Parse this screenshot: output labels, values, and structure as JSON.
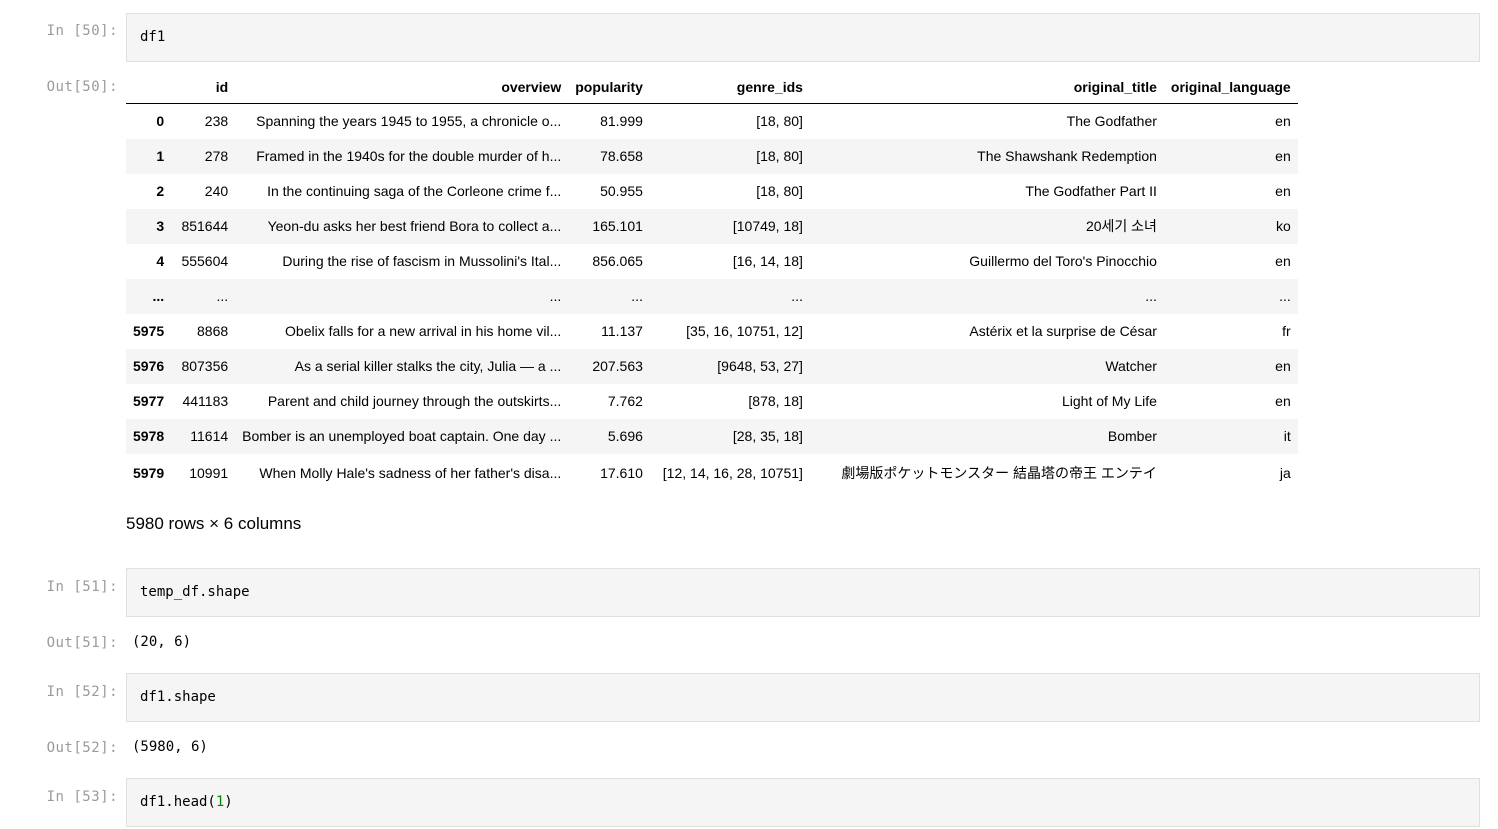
{
  "cells": [
    {
      "in_prompt": "In [50]:",
      "code": "df1",
      "out_prompt": "Out[50]:"
    },
    {
      "in_prompt": "In [51]:",
      "code": "temp_df.shape",
      "out_prompt": "Out[51]:",
      "output": "(20, 6)"
    },
    {
      "in_prompt": "In [52]:",
      "code": "df1.shape",
      "out_prompt": "Out[52]:",
      "output": "(5980, 6)"
    },
    {
      "in_prompt": "In [53]:",
      "code_prefix": "df1.head(",
      "code_arg": "1",
      "code_suffix": ")"
    }
  ],
  "dataframe": {
    "columns": [
      "",
      "id",
      "overview",
      "popularity",
      "genre_ids",
      "original_title",
      "original_language"
    ],
    "rows": [
      [
        "0",
        "238",
        "Spanning the years 1945 to 1955, a chronicle o...",
        "81.999",
        "[18, 80]",
        "The Godfather",
        "en"
      ],
      [
        "1",
        "278",
        "Framed in the 1940s for the double murder of h...",
        "78.658",
        "[18, 80]",
        "The Shawshank Redemption",
        "en"
      ],
      [
        "2",
        "240",
        "In the continuing saga of the Corleone crime f...",
        "50.955",
        "[18, 80]",
        "The Godfather Part II",
        "en"
      ],
      [
        "3",
        "851644",
        "Yeon-du asks her best friend Bora to collect a...",
        "165.101",
        "[10749, 18]",
        "20세기 소녀",
        "ko"
      ],
      [
        "4",
        "555604",
        "During the rise of fascism in Mussolini's Ital...",
        "856.065",
        "[16, 14, 18]",
        "Guillermo del Toro's Pinocchio",
        "en"
      ],
      [
        "...",
        "...",
        "...",
        "...",
        "...",
        "...",
        "..."
      ],
      [
        "5975",
        "8868",
        "Obelix falls for a new arrival in his home vil...",
        "11.137",
        "[35, 16, 10751, 12]",
        "Astérix et la surprise de César",
        "fr"
      ],
      [
        "5976",
        "807356",
        "As a serial killer stalks the city, Julia — a ...",
        "207.563",
        "[9648, 53, 27]",
        "Watcher",
        "en"
      ],
      [
        "5977",
        "441183",
        "Parent and child journey through the outskirts...",
        "7.762",
        "[878, 18]",
        "Light of My Life",
        "en"
      ],
      [
        "5978",
        "11614",
        "Bomber is an unemployed boat captain. One day ...",
        "5.696",
        "[28, 35, 18]",
        "Bomber",
        "it"
      ],
      [
        "5979",
        "10991",
        "When Molly Hale's sadness of her father's disa...",
        "17.610",
        "[12, 14, 16, 28, 10751]",
        "劇場版ポケットモンスター 結晶塔の帝王 エンテイ",
        "ja"
      ]
    ],
    "summary": "5980 rows × 6 columns"
  }
}
